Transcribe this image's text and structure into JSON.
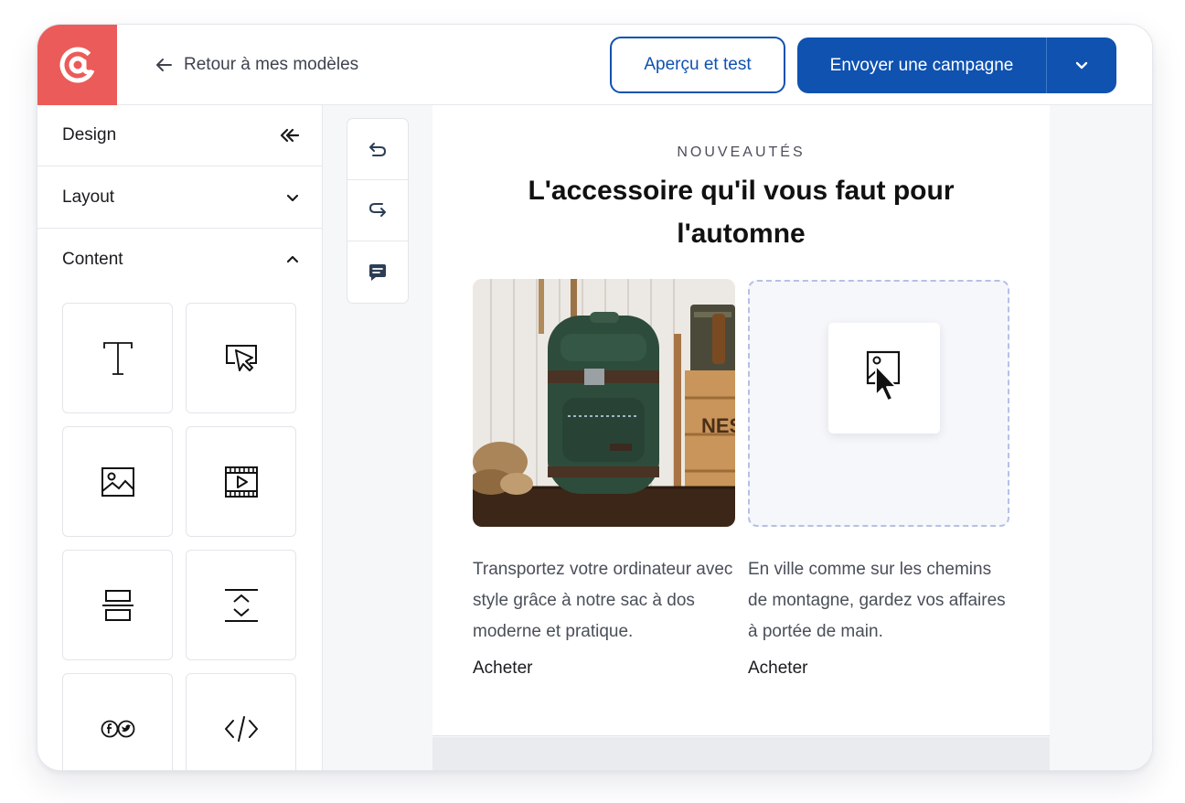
{
  "app": {
    "brand_color": "#eb5b59",
    "accent_color": "#0f52b0",
    "logo_icon": "at-sign-icon"
  },
  "header": {
    "back_label": "Retour à mes modèles",
    "preview_button": "Aperçu et test",
    "send_button": "Envoyer une campagne",
    "send_dropdown_icon": "chevron-down-icon"
  },
  "sidebar": {
    "sections": [
      {
        "label": "Design",
        "icon": "collapse-left-icon"
      },
      {
        "label": "Layout",
        "icon": "chevron-down-icon"
      },
      {
        "label": "Content",
        "icon": "chevron-up-icon"
      }
    ],
    "content_blocks": [
      {
        "name": "text",
        "icon": "text-icon"
      },
      {
        "name": "button",
        "icon": "cursor-button-icon"
      },
      {
        "name": "image",
        "icon": "image-icon"
      },
      {
        "name": "video",
        "icon": "video-icon"
      },
      {
        "name": "divider",
        "icon": "divider-icon"
      },
      {
        "name": "spacer",
        "icon": "spacer-icon"
      },
      {
        "name": "social",
        "icon": "social-icon"
      },
      {
        "name": "html",
        "icon": "code-icon"
      }
    ]
  },
  "toolbar": {
    "tools": [
      {
        "name": "undo",
        "icon": "undo-icon"
      },
      {
        "name": "redo",
        "icon": "redo-icon"
      },
      {
        "name": "comment",
        "icon": "comment-icon"
      }
    ]
  },
  "email": {
    "eyebrow": "NOUVEAUTÉS",
    "headline_line1": "L'accessoire qu'il vous faut pour",
    "headline_line2": "l'automne",
    "columns": [
      {
        "image": "backpack-photo",
        "description": "Transportez votre ordinateur avec style grâce à notre sac à dos moderne et pratique.",
        "cta": "Acheter"
      },
      {
        "image": "image-dropzone",
        "description": "En ville comme sur les chemins de montagne, gardez vos affaires à portée de main.",
        "cta": "Acheter"
      }
    ],
    "crate_text": "NES"
  }
}
